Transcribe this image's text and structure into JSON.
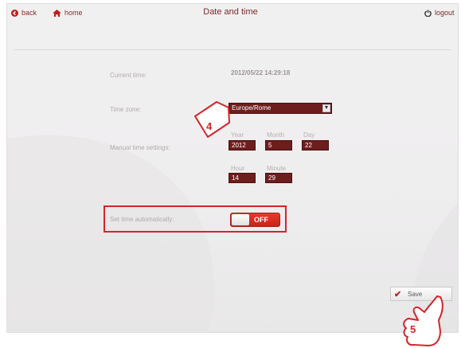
{
  "header": {
    "back_label": "back",
    "home_label": "home",
    "title": "Date and time",
    "logout_label": "logout"
  },
  "settings": {
    "current_time_label": "Current time:",
    "current_time_value": "2012/05/22 14:29:18",
    "time_zone_label": "Time zone:",
    "time_zone_value": "Europe/Rome",
    "manual_label": "Manual time settings:",
    "year_label": "Year",
    "year_value": "2012",
    "month_label": "Month",
    "month_value": "5",
    "day_label": "Day",
    "day_value": "22",
    "hour_label": "Hour",
    "hour_value": "14",
    "minute_label": "Minute",
    "minute_value": "29",
    "auto_label": "Set time automatically:",
    "auto_toggle_state": "OFF"
  },
  "footer": {
    "save_label": "Save"
  },
  "annotations": {
    "step_a": "4",
    "step_b": "5"
  },
  "colors": {
    "accent": "#6e1d1d",
    "highlight": "#d8232a",
    "title_text": "#7b2a2a"
  },
  "icons": {
    "back": "back-arrow-icon",
    "home": "home-icon",
    "logout": "power-icon",
    "save": "check-icon"
  }
}
